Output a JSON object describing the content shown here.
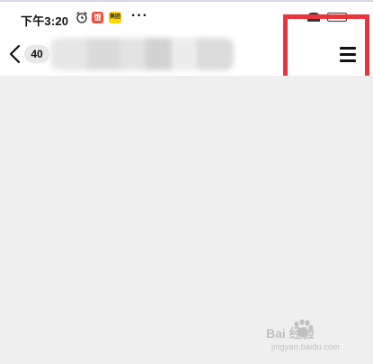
{
  "status_bar": {
    "time": "下午3:20",
    "app_badge_red_label": "饿",
    "app_badge_yellow_label": "美团",
    "more": "···"
  },
  "nav": {
    "unread_count": "40"
  },
  "watermark": {
    "brand_text": "Bai 经验",
    "url": "jingyan.baidu.com"
  }
}
